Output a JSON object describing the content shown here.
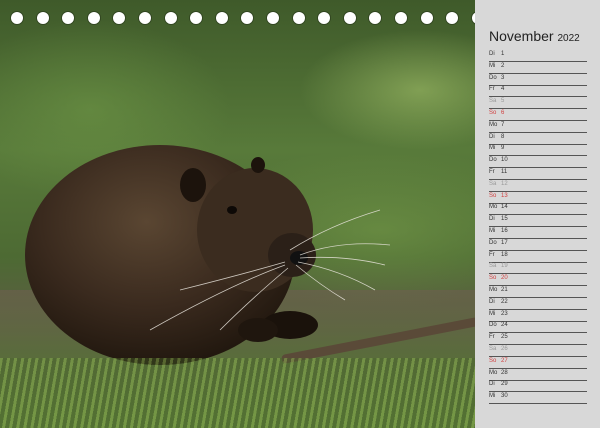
{
  "calendar": {
    "month": "November",
    "year": "2022",
    "days": [
      {
        "name": "Di",
        "num": "1",
        "type": "weekday"
      },
      {
        "name": "Mi",
        "num": "2",
        "type": "weekday"
      },
      {
        "name": "Do",
        "num": "3",
        "type": "weekday"
      },
      {
        "name": "Fr",
        "num": "4",
        "type": "weekday"
      },
      {
        "name": "Sa",
        "num": "5",
        "type": "saturday"
      },
      {
        "name": "So",
        "num": "6",
        "type": "sunday"
      },
      {
        "name": "Mo",
        "num": "7",
        "type": "weekday"
      },
      {
        "name": "Di",
        "num": "8",
        "type": "weekday"
      },
      {
        "name": "Mi",
        "num": "9",
        "type": "weekday"
      },
      {
        "name": "Do",
        "num": "10",
        "type": "weekday"
      },
      {
        "name": "Fr",
        "num": "11",
        "type": "weekday"
      },
      {
        "name": "Sa",
        "num": "12",
        "type": "saturday"
      },
      {
        "name": "So",
        "num": "13",
        "type": "sunday"
      },
      {
        "name": "Mo",
        "num": "14",
        "type": "weekday"
      },
      {
        "name": "Di",
        "num": "15",
        "type": "weekday"
      },
      {
        "name": "Mi",
        "num": "16",
        "type": "weekday"
      },
      {
        "name": "Do",
        "num": "17",
        "type": "weekday"
      },
      {
        "name": "Fr",
        "num": "18",
        "type": "weekday"
      },
      {
        "name": "Sa",
        "num": "19",
        "type": "saturday"
      },
      {
        "name": "So",
        "num": "20",
        "type": "sunday"
      },
      {
        "name": "Mo",
        "num": "21",
        "type": "weekday"
      },
      {
        "name": "Di",
        "num": "22",
        "type": "weekday"
      },
      {
        "name": "Mi",
        "num": "23",
        "type": "weekday"
      },
      {
        "name": "Do",
        "num": "24",
        "type": "weekday"
      },
      {
        "name": "Fr",
        "num": "25",
        "type": "weekday"
      },
      {
        "name": "Sa",
        "num": "26",
        "type": "saturday"
      },
      {
        "name": "So",
        "num": "27",
        "type": "sunday"
      },
      {
        "name": "Mo",
        "num": "28",
        "type": "weekday"
      },
      {
        "name": "Di",
        "num": "29",
        "type": "weekday"
      },
      {
        "name": "Mi",
        "num": "30",
        "type": "weekday"
      }
    ]
  },
  "photo": {
    "subject": "nutria-photo"
  },
  "colors": {
    "sidebar": "#d8d8d8",
    "sunday": "#d04040",
    "saturday": "#999999"
  }
}
